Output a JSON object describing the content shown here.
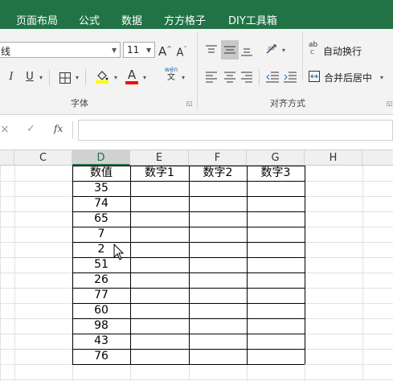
{
  "tabs": [
    "页面布局",
    "公式",
    "数据",
    "方方格子",
    "DIY工具箱"
  ],
  "font": {
    "name_value": "线",
    "size_value": "11",
    "grow_label": "A",
    "shrink_label": "A",
    "italic_label": "I",
    "underline_label": "U",
    "fill_color": "#ffff00",
    "font_color": "#ff0000",
    "phonetic_top": "wén",
    "phonetic_bottom": "文",
    "group_label": "字体"
  },
  "alignment": {
    "wrap_label": "自动换行",
    "merge_label": "合并后居中",
    "group_label": "对齐方式",
    "wrap_icon_top": "ab",
    "wrap_icon_bottom": "c"
  },
  "formula_bar": {
    "cancel_glyph": "×",
    "enter_glyph": "✓",
    "fx_label": "fx",
    "value": ""
  },
  "columns": [
    "C",
    "D",
    "E",
    "F",
    "G",
    "H"
  ],
  "selected_column": "D",
  "table": {
    "headers": [
      "数值",
      "数字1",
      "数字2",
      "数字3"
    ],
    "values": [
      "35",
      "74",
      "65",
      "7",
      "2",
      "51",
      "26",
      "77",
      "60",
      "98",
      "43",
      "76"
    ]
  },
  "colors": {
    "excel_green": "#217346"
  }
}
